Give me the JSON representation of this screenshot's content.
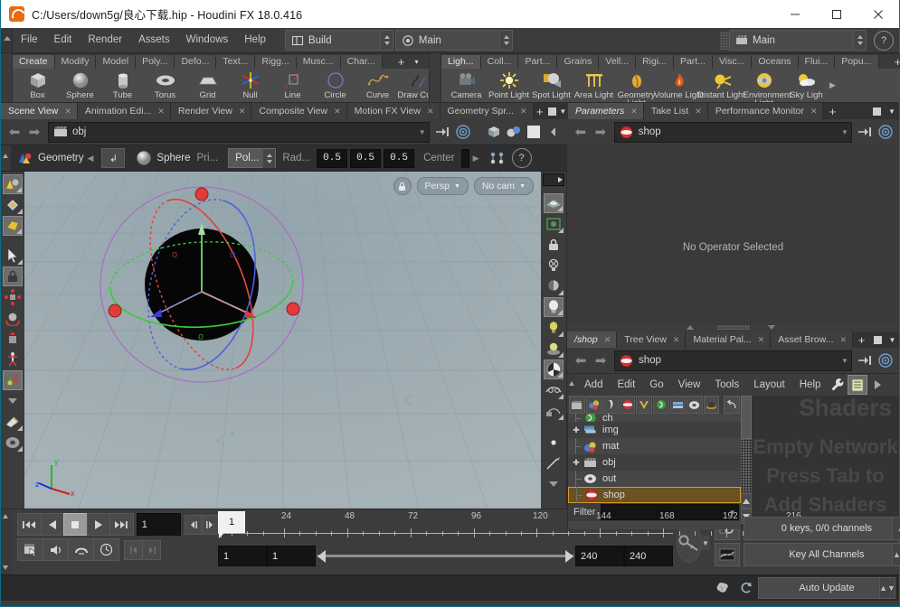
{
  "window": {
    "title": "C:/Users/down5g/良心下载.hip - Houdini FX 18.0.416",
    "app_icon": "houdini-logo-icon",
    "minimize": "—",
    "maximize": "□",
    "close": "✕"
  },
  "menubar": {
    "items": [
      "File",
      "Edit",
      "Render",
      "Assets",
      "Windows",
      "Help"
    ],
    "desktop_combo": {
      "label": "Build",
      "icon": "layout-icon"
    },
    "main_combo": {
      "label": "Main",
      "icon": "target-icon"
    },
    "right_combo": {
      "label": "Main",
      "icon": "clapper-icon"
    },
    "help_icon": "question-mark-icon"
  },
  "shelf_left": {
    "tabs": [
      "Create",
      "Modify",
      "Model",
      "Poly...",
      "Defo...",
      "Text...",
      "Rigg...",
      "Musc...",
      "Char..."
    ],
    "selected": "Create",
    "add_label": "+",
    "menu_label": "▾",
    "tools": [
      {
        "label": "Box",
        "icon": "box-icon"
      },
      {
        "label": "Sphere",
        "icon": "sphere-icon"
      },
      {
        "label": "Tube",
        "icon": "tube-icon"
      },
      {
        "label": "Torus",
        "icon": "torus-icon"
      },
      {
        "label": "Grid",
        "icon": "grid-icon"
      },
      {
        "label": "Null",
        "icon": "null-icon"
      },
      {
        "label": "Line",
        "icon": "line-icon"
      },
      {
        "label": "Circle",
        "icon": "circle-icon"
      },
      {
        "label": "Curve",
        "icon": "curve-icon"
      },
      {
        "label": "Draw Curve",
        "icon": "draw-curve-icon"
      }
    ]
  },
  "shelf_right": {
    "tabs": [
      "Ligh...",
      "Coll...",
      "Part...",
      "Grains",
      "Vell...",
      "Rigi...",
      "Part...",
      "Visc...",
      "Oceans",
      "Flui...",
      "Popu..."
    ],
    "selected": "Ligh...",
    "add_label": "+",
    "menu_label": "▾",
    "tools": [
      {
        "label": "Camera",
        "icon": "camera-icon"
      },
      {
        "label": "Point Light",
        "icon": "point-light-icon"
      },
      {
        "label": "Spot Light",
        "icon": "spot-light-icon"
      },
      {
        "label": "Area Light",
        "icon": "area-light-icon"
      },
      {
        "label": "Geometry Light",
        "icon": "geometry-light-icon"
      },
      {
        "label": "Volume Light",
        "icon": "volume-light-icon"
      },
      {
        "label": "Distant Light",
        "icon": "distant-light-icon"
      },
      {
        "label": "Environment Light",
        "icon": "environment-light-icon"
      },
      {
        "label": "Sky Ligh",
        "icon": "sky-light-icon"
      }
    ]
  },
  "viewport_pane": {
    "tabs": [
      {
        "label": "Scene View",
        "selected": true
      },
      {
        "label": "Animation Edi...",
        "selected": false
      },
      {
        "label": "Render View",
        "selected": false
      },
      {
        "label": "Composite View",
        "selected": false
      },
      {
        "label": "Motion FX View",
        "selected": false
      },
      {
        "label": "Geometry Spr...",
        "selected": false
      }
    ],
    "path": {
      "value": "obj",
      "icon": "obj-network-icon"
    },
    "param_strip": {
      "context": "Geometry",
      "context_icon": "geometry-icon",
      "node_icon": "sphere-node-icon",
      "node_name": "Sphere",
      "primitive_label": "Pri...",
      "primitive_value": "Pol...",
      "radius_label": "Rad...",
      "radius": [
        "0.5",
        "0.5",
        "0.5"
      ],
      "center_label": "Center",
      "help_icon": "question-mark-icon"
    },
    "hud": {
      "lock_icon": "lock-icon",
      "view_mode": "Persp",
      "camera": "No cam"
    },
    "gnomon": {
      "x": "x",
      "y": "y",
      "z": "z"
    },
    "scene": {
      "object": "sphere",
      "manipulator": "rotate-handle",
      "axis_colors": {
        "x": "#e03030",
        "y": "#30c030",
        "z": "#3050e0"
      },
      "ring_colors": [
        "#e14a4a",
        "#3ccb3c",
        "#4a62e0",
        "#b07ac0"
      ]
    }
  },
  "params_pane": {
    "tabs": [
      {
        "label": "Parameters",
        "selected": true
      },
      {
        "label": "Take List",
        "selected": false
      },
      {
        "label": "Performance Monitor",
        "selected": false
      }
    ],
    "path": {
      "value": "shop",
      "icon": "shop-network-icon"
    },
    "empty_message": "No Operator Selected"
  },
  "network_pane": {
    "tabs": [
      {
        "label": "/shop",
        "selected": true
      },
      {
        "label": "Tree View",
        "selected": false
      },
      {
        "label": "Material Pal...",
        "selected": false
      },
      {
        "label": "Asset Brow...",
        "selected": false
      }
    ],
    "path": {
      "value": "shop",
      "icon": "shop-network-icon"
    },
    "menu": [
      "Add",
      "Edit",
      "Go",
      "View",
      "Tools",
      "Layout",
      "Help"
    ],
    "menu_icons": [
      "wrench-icon",
      "list-view-icon",
      "play-arrow-icon"
    ],
    "toolbar_icons": [
      "obj-icon",
      "mat-icon",
      "chop-icon",
      "shop-icon",
      "vop-icon",
      "dop-icon",
      "cop-icon",
      "out-icon",
      "top-icon",
      "jump-back-icon"
    ],
    "tree": [
      {
        "label": "ch",
        "icon": "chop-icon",
        "expandable": false,
        "selected": false,
        "clipped": true
      },
      {
        "label": "img",
        "icon": "img-icon",
        "expandable": true,
        "selected": false
      },
      {
        "label": "mat",
        "icon": "mat-icon",
        "expandable": false,
        "selected": false
      },
      {
        "label": "obj",
        "icon": "obj-icon",
        "expandable": true,
        "selected": false
      },
      {
        "label": "out",
        "icon": "out-icon",
        "expandable": false,
        "selected": false
      },
      {
        "label": "shop",
        "icon": "shop-icon",
        "expandable": false,
        "selected": true
      }
    ],
    "filter": {
      "label": "Filter",
      "value": ""
    },
    "canvas_watermark": [
      "Shaders",
      "Empty Network",
      "Press Tab to",
      "Add Shaders"
    ]
  },
  "playbar": {
    "transport": [
      {
        "icon": "jump-start-icon",
        "name": "jump-to-start"
      },
      {
        "icon": "play-reverse-icon",
        "name": "play-reverse"
      },
      {
        "icon": "stop-icon",
        "name": "stop",
        "active": true
      },
      {
        "icon": "play-icon",
        "name": "play-forward"
      },
      {
        "icon": "jump-end-icon",
        "name": "jump-to-end"
      }
    ],
    "current_frame": "1",
    "step_back_icon": "step-back-icon",
    "step_fwd_icon": "step-forward-icon",
    "tools": [
      {
        "icon": "auto-key-icon",
        "name": "keyframe-mode"
      },
      {
        "icon": "audio-icon",
        "name": "audio-panel"
      },
      {
        "icon": "snap-icon",
        "name": "snapping"
      },
      {
        "icon": "time-icon",
        "name": "time-settings"
      }
    ],
    "nav": [
      {
        "icon": "prev-key-icon",
        "name": "previous-key",
        "disabled": true
      },
      {
        "icon": "next-key-icon",
        "name": "next-key",
        "disabled": true
      }
    ],
    "ruler_labels": [
      "24",
      "48",
      "72",
      "96",
      "120",
      "144",
      "168",
      "192",
      "216"
    ],
    "range_start": "1",
    "range_playstart": "1",
    "range_playend": "240",
    "range_end": "240",
    "key_icon": "key-icon",
    "channel_icon": "channel-list-icon",
    "graph_icon": "animation-graph-icon",
    "keys_label": "0 keys, 0/0 channels",
    "key_all_label": "Key All Channels"
  },
  "statusbar": {
    "brain_icon": "cook-icon",
    "refresh_icon": "refresh-icon",
    "update_mode": "Auto Update"
  },
  "colors": {
    "accent": "#0c6d86",
    "panel_bg": "#3c3c3c",
    "dark_bg": "#2a2a2a",
    "field_bg": "#141414",
    "selection": "#d89a2a",
    "text": "#c8c8c8"
  }
}
